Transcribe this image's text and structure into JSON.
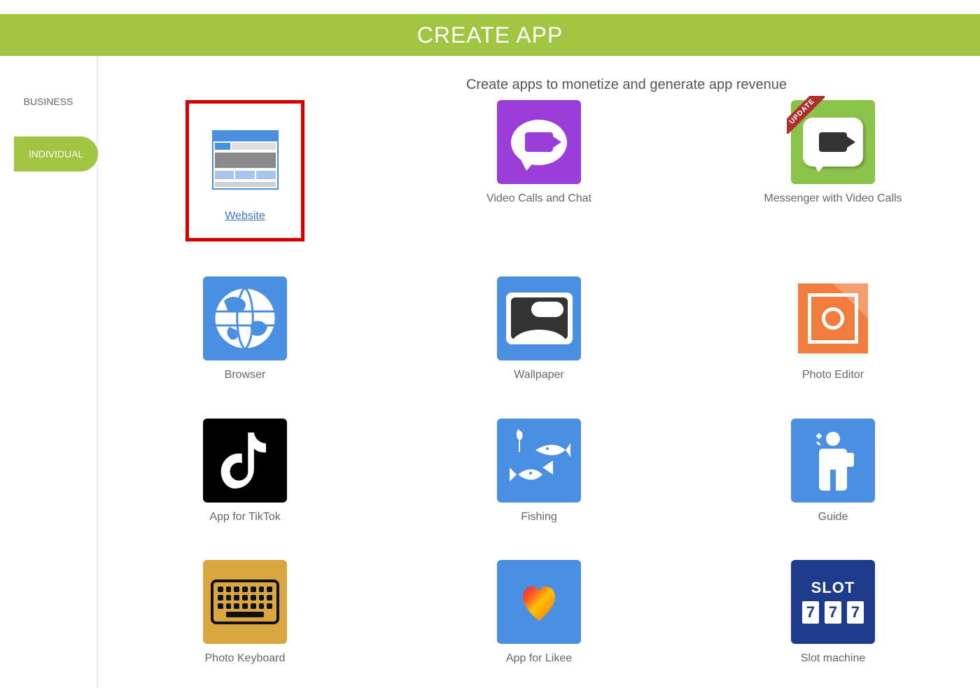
{
  "header": {
    "title": "CREATE APP"
  },
  "sidebar": {
    "items": [
      {
        "label": "BUSINESS",
        "active": false
      },
      {
        "label": "INDIVIDUAL",
        "active": true
      }
    ]
  },
  "main": {
    "subtitle": "Create apps to monetize and generate app revenue",
    "badge_update": "UPDATE",
    "slot_title": "SLOT",
    "slot_digit": "7",
    "cards": [
      {
        "label": "Website",
        "icon": "website-icon",
        "selected": true
      },
      {
        "label": "Video Calls and Chat",
        "icon": "video-chat-icon"
      },
      {
        "label": "Messenger with Video Calls",
        "icon": "messenger-video-icon",
        "badge": "UPDATE"
      },
      {
        "label": "Browser",
        "icon": "globe-icon"
      },
      {
        "label": "Wallpaper",
        "icon": "wallpaper-icon"
      },
      {
        "label": "Photo Editor",
        "icon": "photo-editor-icon"
      },
      {
        "label": "App for TikTok",
        "icon": "tiktok-icon"
      },
      {
        "label": "Fishing",
        "icon": "fishing-icon"
      },
      {
        "label": "Guide",
        "icon": "guide-icon"
      },
      {
        "label": "Photo Keyboard",
        "icon": "keyboard-icon"
      },
      {
        "label": "App for Likee",
        "icon": "likee-icon"
      },
      {
        "label": "Slot machine",
        "icon": "slot-icon"
      }
    ]
  }
}
